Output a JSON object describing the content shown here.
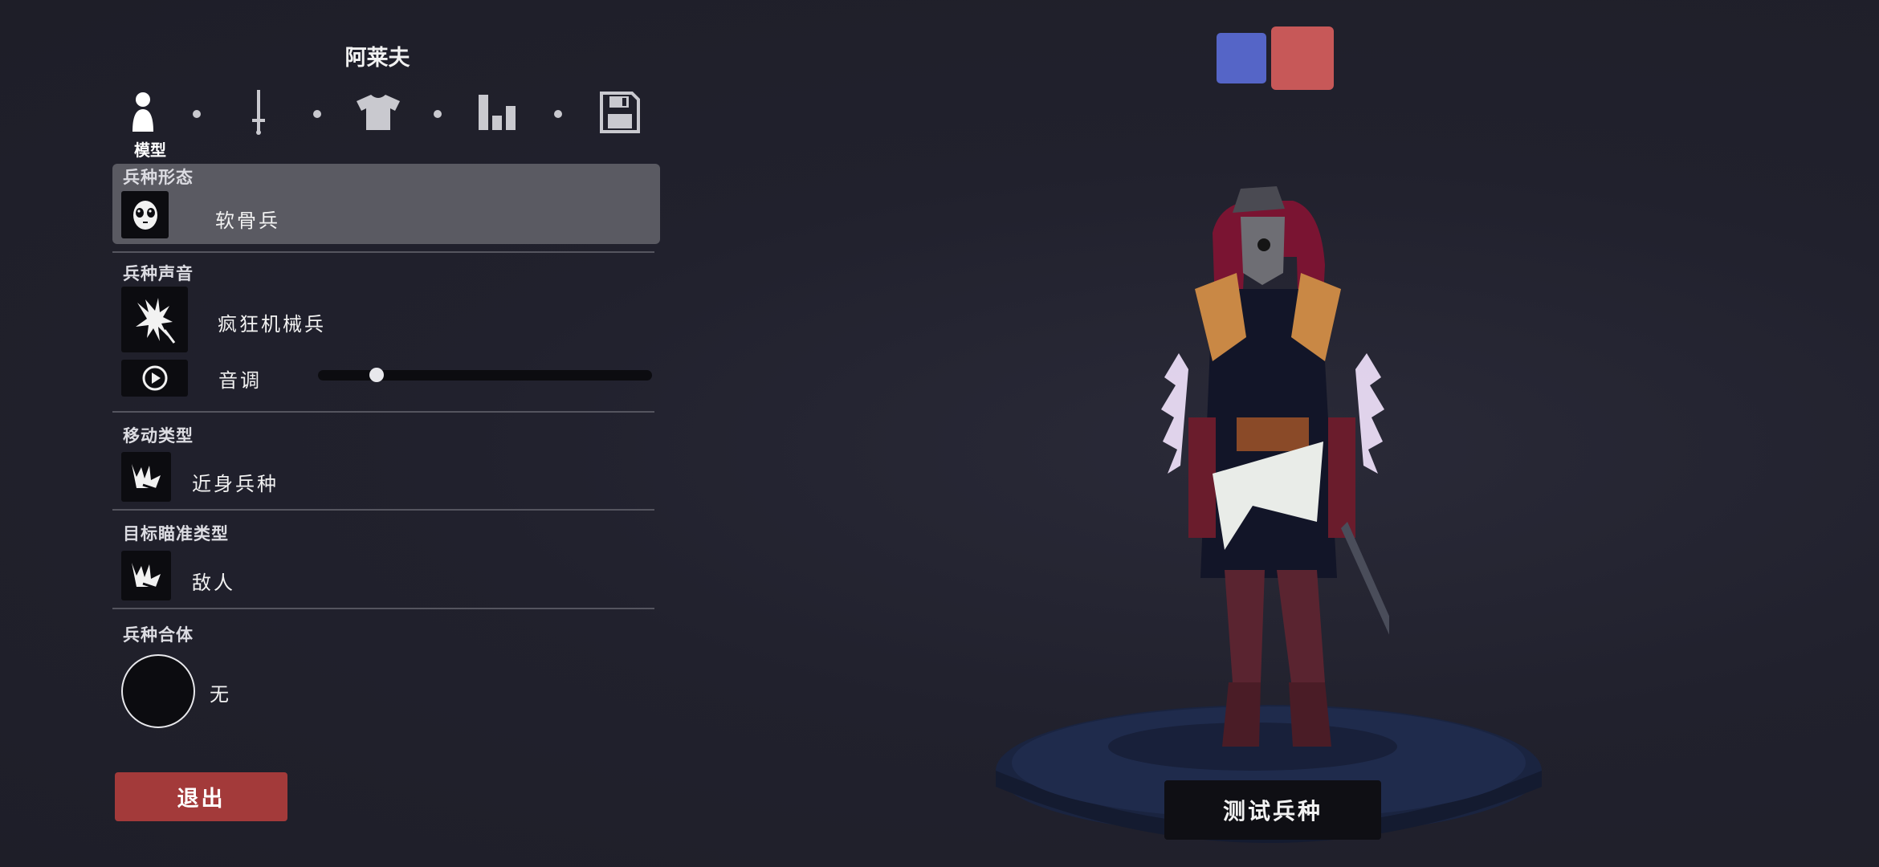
{
  "header": {
    "title": "阿莱夫"
  },
  "stepper": {
    "steps": [
      {
        "icon": "person-icon",
        "label": "模型"
      },
      {
        "icon": "sword-icon"
      },
      {
        "icon": "shirt-icon"
      },
      {
        "icon": "bar-chart-icon"
      },
      {
        "icon": "save-icon"
      }
    ]
  },
  "sections": {
    "form": {
      "title": "兵种形态",
      "value": "软骨兵",
      "icon": "alien-face-icon"
    },
    "voice": {
      "title": "兵种声音",
      "value": "疯狂机械兵",
      "icon": "creature-icon",
      "pitch_label": "音调",
      "pitch_value": 0.16,
      "play_icon": "play-icon"
    },
    "movement": {
      "title": "移动类型",
      "value": "近身兵种",
      "icon": "melee-crown-icon"
    },
    "targeting": {
      "title": "目标瞄准类型",
      "value": "敌人",
      "icon": "melee-crown-icon"
    },
    "combine": {
      "title": "兵种合体",
      "value": "无"
    }
  },
  "buttons": {
    "exit": "退出",
    "test_unit": "测试兵种"
  },
  "teams": {
    "blue": "#5565c7",
    "red": "#c75858"
  }
}
